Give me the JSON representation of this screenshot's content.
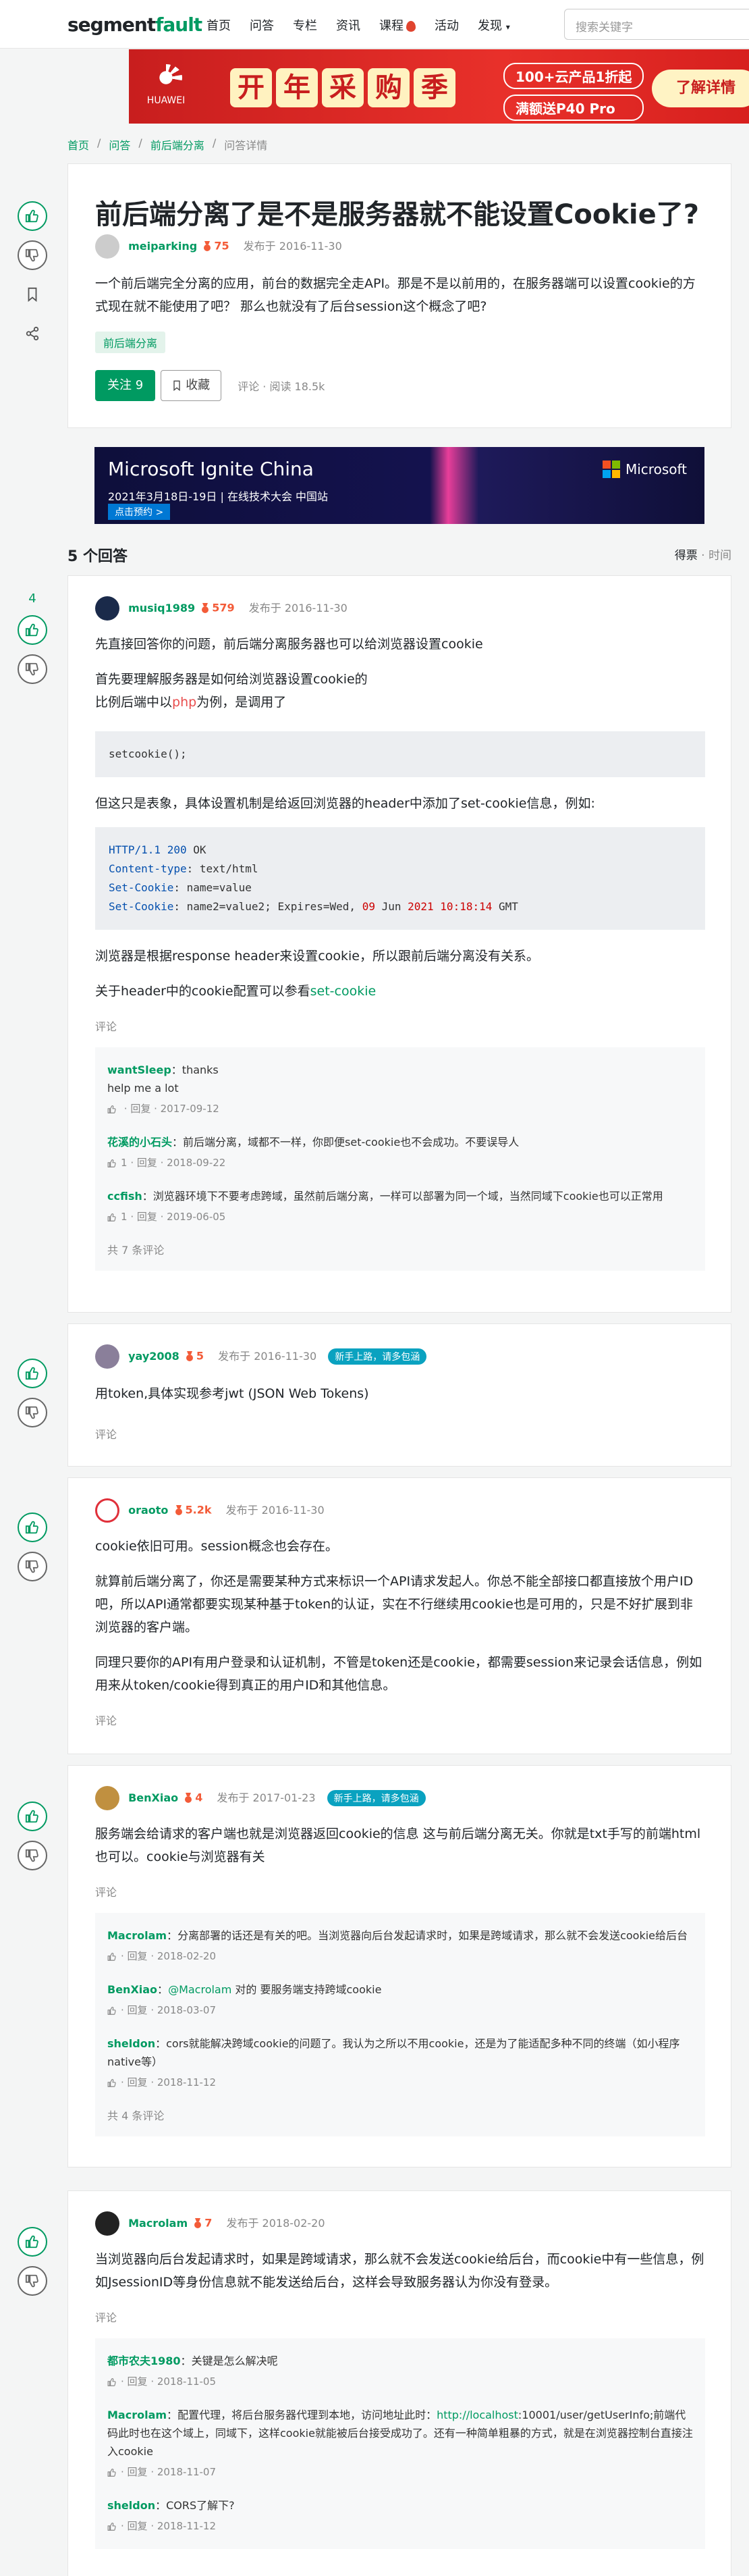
{
  "header": {
    "logo_a": "segment",
    "logo_b": "fault",
    "nav": [
      "首页",
      "问答",
      "专栏",
      "资讯",
      "课程",
      "活动",
      "发现"
    ],
    "search_placeholder": "搜索关键字"
  },
  "banner": {
    "brand": "HUAWEI",
    "chars": [
      "开",
      "年",
      "采",
      "购",
      "季"
    ],
    "badge1": "100+云产品1折起",
    "badge2": "满额送P40 Pro",
    "button": "了解详情"
  },
  "breadcrumb": [
    "首页",
    "问答",
    "前后端分离",
    "问答详情"
  ],
  "question": {
    "title": "前后端分离了是不是服务器就不能设置Cookie了?",
    "author": "meiparking",
    "rep": "75",
    "posted": "发布于 2016-11-30",
    "body": "一个前后端完全分离的应用，前台的数据完全走API。那是不是以前用的，在服务器端可以设置cookie的方式现在就不能使用了吧？ 那么也就没有了后台session这个概念了吧?",
    "tag": "前后端分离",
    "follow": "关注 9",
    "collect": "收藏",
    "stats": "评论 · 阅读 18.5k"
  },
  "ad": {
    "title": "Microsoft Ignite China",
    "date": "2021年3月18日-19日 | 在线技术大会 中国站",
    "cta": "点击预约 >",
    "brand": "Microsoft"
  },
  "answers_header": {
    "count": "5 个回答",
    "sort_a": "得票",
    "sort_sep": " · ",
    "sort_b": "时间"
  },
  "answers": [
    {
      "votes": "4",
      "author": "musiq1989",
      "rep": "579",
      "posted": "发布于 2016-11-30",
      "p1": "先直接回答你的问题，前后端分离服务器也可以给浏览器设置cookie",
      "p2": "首先要理解服务器是如何给浏览器设置cookie的",
      "p3a": "比例后端中以",
      "p3b": "php",
      "p3c": "为例，是调用了",
      "code1": "setcookie();",
      "p4": "但这只是表象，具体设置机制是给返回浏览器的header中添加了set-cookie信息，例如:",
      "code2": {
        "l1a": "HTTP/1.1 ",
        "l1b": "200",
        "l1c": " OK",
        "l2a": "Content-type",
        "l2b": ": text/html",
        "l3a": "Set-Cookie",
        "l3b": ": name=value",
        "l4a": "Set-Cookie",
        "l4b": ": name2=value2; Expires=Wed, ",
        "l4c": "09",
        "l4d": " Jun ",
        "l4e": "2021",
        "l4f": " ",
        "l4g": "10:18:14",
        "l4h": " GMT"
      },
      "p5": "浏览器是根据response header来设置cookie，所以跟前后端分离没有关系。",
      "p6a": "关于header中的cookie配置可以参看",
      "p6b": "set-cookie",
      "comment_link": "评论",
      "comments": [
        {
          "user": "wantSleep",
          "text": "thanks",
          "text2": "help me a lot",
          "likes": "",
          "meta": "回复 · 2017-09-12"
        },
        {
          "user": "花溪的小石头",
          "text": "前后端分离，域都不一样，你即便set-cookie也不会成功。不要误导人",
          "likes": "1",
          "meta": "回复 · 2018-09-22"
        },
        {
          "user": "ccfish",
          "text": "浏览器环境下不要考虑跨域，虽然前后端分离，一样可以部署为同一个域，当然同域下cookie也可以正常用",
          "likes": "1",
          "meta": "回复 · 2019-06-05"
        }
      ],
      "more": "共 7 条评论"
    },
    {
      "author": "yay2008",
      "rep": "5",
      "posted": "发布于 2016-11-30",
      "badge": "新手上路，请多包涵",
      "p1": "用token,具体实现参考jwt (JSON Web Tokens)",
      "comment_link": "评论"
    },
    {
      "author": "oraoto",
      "rep": "5.2k",
      "posted": "发布于 2016-11-30",
      "p1": "cookie依旧可用。session概念也会存在。",
      "p2": "就算前后端分离了，你还是需要某种方式来标识一个API请求发起人。你总不能全部接口都直接放个用户ID吧，所以API通常都要实现某种基于token的认证，实在不行继续用cookie也是可用的，只是不好扩展到非浏览器的客户端。",
      "p3": "同理只要你的API有用户登录和认证机制，不管是token还是cookie，都需要session来记录会话信息，例如用来从token/cookie得到真正的用户ID和其他信息。",
      "comment_link": "评论"
    },
    {
      "author": "BenXiao",
      "rep": "4",
      "posted": "发布于 2017-01-23",
      "badge": "新手上路，请多包涵",
      "p1": "服务端会给请求的客户端也就是浏览器返回cookie的信息 这与前后端分离无关。你就是txt手写的前端html也可以。cookie与浏览器有关",
      "comment_link": "评论",
      "comments": [
        {
          "user": "Macrolam",
          "text": "分离部署的话还是有关的吧。当浏览器向后台发起请求时，如果是跨域请求，那么就不会发送cookie给后台",
          "meta": "回复 · 2018-02-20"
        },
        {
          "user": "BenXiao",
          "at": "@Macrolam",
          "text": " 对的 要服务端支持跨域cookie",
          "meta": "回复 · 2018-03-07"
        },
        {
          "user": "sheldon",
          "text": "cors就能解决跨域cookie的问题了。我认为之所以不用cookie，还是为了能适配多种不同的终端（如小程序 native等）",
          "meta": "回复 · 2018-11-12"
        }
      ],
      "more": "共 4 条评论"
    },
    {
      "author": "Macrolam",
      "rep": "7",
      "posted": "发布于 2018-02-20",
      "p1": "当浏览器向后台发起请求时，如果是跨域请求，那么就不会发送cookie给后台，而cookie中有一些信息，例如JsessionID等身份信息就不能发送给后台，这样会导致服务器认为你没有登录。",
      "comment_link": "评论",
      "comments": [
        {
          "user": "都市农夫1980",
          "text": "关键是怎么解决呢",
          "meta": "回复 · 2018-11-05"
        },
        {
          "user": "Macrolam",
          "text": "配置代理，将后台服务器代理到本地，访问地址此时：",
          "link": "http://localhost",
          "text2": ":10001/user/getUserInfo;前端代码此时也在这个域上，同域下，这样cookie就能被后台接受成功了。还有一种简单粗暴的方式，就是在浏览器控制台直接注入cookie",
          "meta": "回复 · 2018-11-07"
        },
        {
          "user": "sheldon",
          "text": "CORS了解下?",
          "meta": "回复 · 2018-11-12"
        }
      ]
    }
  ]
}
